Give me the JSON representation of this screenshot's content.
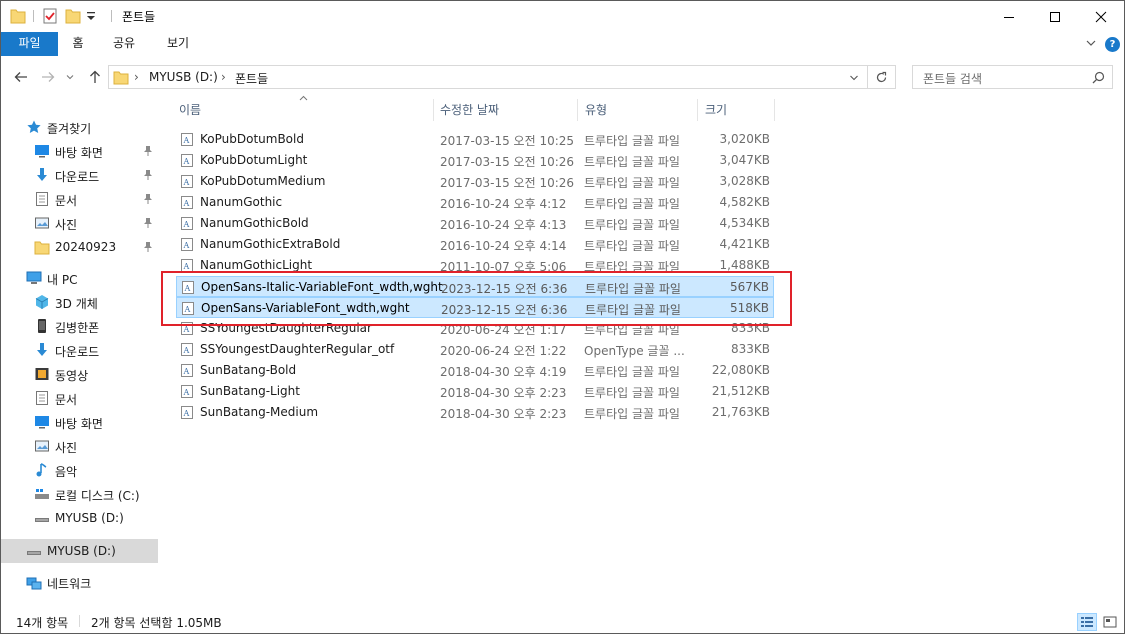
{
  "window": {
    "title": "폰트들",
    "controls": {
      "minimize": "minimize",
      "maximize": "maximize",
      "close": "close"
    }
  },
  "ribbon": {
    "tabs": [
      "파일",
      "홈",
      "공유",
      "보기"
    ],
    "help": "?"
  },
  "address": {
    "path": [
      "MYUSB (D:)",
      "폰트들"
    ]
  },
  "search": {
    "placeholder": "폰트들 검색"
  },
  "sidebar": {
    "quick_access_label": "즐겨찾기",
    "quick_access": [
      {
        "label": "바탕 화면",
        "icon": "desktop-icon",
        "pinned": true
      },
      {
        "label": "다운로드",
        "icon": "download-icon",
        "pinned": true
      },
      {
        "label": "문서",
        "icon": "document-icon",
        "pinned": true
      },
      {
        "label": "사진",
        "icon": "pictures-icon",
        "pinned": true
      },
      {
        "label": "20240923",
        "icon": "folder-icon",
        "pinned": true
      }
    ],
    "this_pc_label": "내 PC",
    "this_pc": [
      {
        "label": "3D 개체",
        "icon": "3d-objects-icon"
      },
      {
        "label": "김병한폰",
        "icon": "phone-icon"
      },
      {
        "label": "다운로드",
        "icon": "download-icon"
      },
      {
        "label": "동영상",
        "icon": "video-icon"
      },
      {
        "label": "문서",
        "icon": "document-icon"
      },
      {
        "label": "바탕 화면",
        "icon": "desktop-icon"
      },
      {
        "label": "사진",
        "icon": "pictures-icon"
      },
      {
        "label": "음악",
        "icon": "music-icon"
      },
      {
        "label": "로컬 디스크 (C:)",
        "icon": "local-disk-icon"
      },
      {
        "label": "MYUSB (D:)",
        "icon": "usb-drive-icon"
      }
    ],
    "drive_selected": "MYUSB (D:)",
    "network_label": "네트워크"
  },
  "columns": {
    "name": "이름",
    "date": "수정한 날짜",
    "type": "유형",
    "size": "크기"
  },
  "files": [
    {
      "name": "KoPubDotumBold",
      "date": "2017-03-15 오전 10:25",
      "type": "트루타입 글꼴 파일",
      "size": "3,020KB",
      "selected": false
    },
    {
      "name": "KoPubDotumLight",
      "date": "2017-03-15 오전 10:26",
      "type": "트루타입 글꼴 파일",
      "size": "3,047KB",
      "selected": false
    },
    {
      "name": "KoPubDotumMedium",
      "date": "2017-03-15 오전 10:26",
      "type": "트루타입 글꼴 파일",
      "size": "3,028KB",
      "selected": false
    },
    {
      "name": "NanumGothic",
      "date": "2016-10-24 오후 4:12",
      "type": "트루타입 글꼴 파일",
      "size": "4,582KB",
      "selected": false
    },
    {
      "name": "NanumGothicBold",
      "date": "2016-10-24 오후 4:13",
      "type": "트루타입 글꼴 파일",
      "size": "4,534KB",
      "selected": false
    },
    {
      "name": "NanumGothicExtraBold",
      "date": "2016-10-24 오후 4:14",
      "type": "트루타입 글꼴 파일",
      "size": "4,421KB",
      "selected": false
    },
    {
      "name": "NanumGothicLight",
      "date": "2011-10-07 오후 5:06",
      "type": "트루타입 글꼴 파일",
      "size": "1,488KB",
      "selected": false
    },
    {
      "name": "OpenSans-Italic-VariableFont_wdth,wght",
      "date": "2023-12-15 오전 6:36",
      "type": "트루타입 글꼴 파일",
      "size": "567KB",
      "selected": true
    },
    {
      "name": "OpenSans-VariableFont_wdth,wght",
      "date": "2023-12-15 오전 6:36",
      "type": "트루타입 글꼴 파일",
      "size": "518KB",
      "selected": true
    },
    {
      "name": "SSYoungestDaughterRegular",
      "date": "2020-06-24 오전 1:17",
      "type": "트루타입 글꼴 파일",
      "size": "833KB",
      "selected": false
    },
    {
      "name": "SSYoungestDaughterRegular_otf",
      "date": "2020-06-24 오전 1:22",
      "type": "OpenType 글꼴 ...",
      "size": "833KB",
      "selected": false
    },
    {
      "name": "SunBatang-Bold",
      "date": "2018-04-30 오후 4:19",
      "type": "트루타입 글꼴 파일",
      "size": "22,080KB",
      "selected": false
    },
    {
      "name": "SunBatang-Light",
      "date": "2018-04-30 오후 2:23",
      "type": "트루타입 글꼴 파일",
      "size": "21,512KB",
      "selected": false
    },
    {
      "name": "SunBatang-Medium",
      "date": "2018-04-30 오후 2:23",
      "type": "트루타입 글꼴 파일",
      "size": "21,763KB",
      "selected": false
    }
  ],
  "status": {
    "item_count": "14개 항목",
    "selection": "2개 항목 선택함 1.05MB"
  },
  "colors": {
    "accent": "#1979ca",
    "selection_bg": "#cce8ff",
    "selection_border": "#99d1ff",
    "highlight_box": "#e0222a"
  }
}
